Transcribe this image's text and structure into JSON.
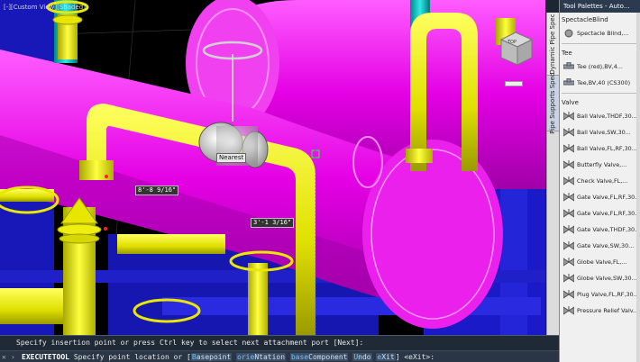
{
  "viewport": {
    "label": "[-][Custom View][Shaded]",
    "nav_cube_label": "TOP",
    "snap_tooltip": "Nearest",
    "dim_tooltip_1": "8'-8 9/16\"",
    "dim_tooltip_2": "3'-1 3/16\""
  },
  "vertical_tabs": [
    "Dynamic Pipe Spec",
    "Pipe Supports Spec"
  ],
  "palette": {
    "title": "Tool Palettes - Auto...",
    "close": "✕",
    "sections": [
      {
        "title": "SpectacleBlind",
        "items": [
          "Spectacle Blind,..."
        ]
      },
      {
        "title": "Tee",
        "items": [
          "Tee (red),BV,4...",
          "Tee,BV,40 (CS300)"
        ]
      },
      {
        "title": "Valve",
        "items": [
          "Ball Valve,THDF,30...",
          "Ball Valve,SW,30...",
          "Ball Valve,FL,RF,30...",
          "Butterfly Valve,...",
          "Check Valve,FL,...",
          "Gate Valve,FL,RF,30...",
          "Gate Valve,FL,RF,30...",
          "Gate Valve,THDF,30...",
          "Gate Valve,SW,30...",
          "Globe Valve,FL,...",
          "Globe Valve,SW,30...",
          "Plug Valve,FL,RF,30...",
          "Pressure Relief Valv..."
        ]
      }
    ]
  },
  "command": {
    "history": "Specify insertion point or press Ctrl key to select next attachment port [Next]:",
    "close_icon": "✕",
    "prompt_icon": "›",
    "command_name": "EXECUTETOOL",
    "prompt_text": "Specify point location or [",
    "options": [
      {
        "key": "B",
        "rest": "asepoint",
        "label": "Basepoint"
      },
      {
        "key": "orie",
        "rest": "Ntation",
        "label": "orieNtation"
      },
      {
        "key": "base",
        "rest": "Component",
        "label": "baseComponent"
      },
      {
        "key": "U",
        "rest": "ndo",
        "label": "Undo"
      },
      {
        "key": "e",
        "rest": "Xit",
        "label": "eXit"
      }
    ],
    "suffix": "] <eXit>:"
  },
  "colors": {
    "vessel": "#e800e8",
    "pipe": "#e8e800",
    "steel": "#2020d0",
    "valve": "#c0c0c0"
  }
}
